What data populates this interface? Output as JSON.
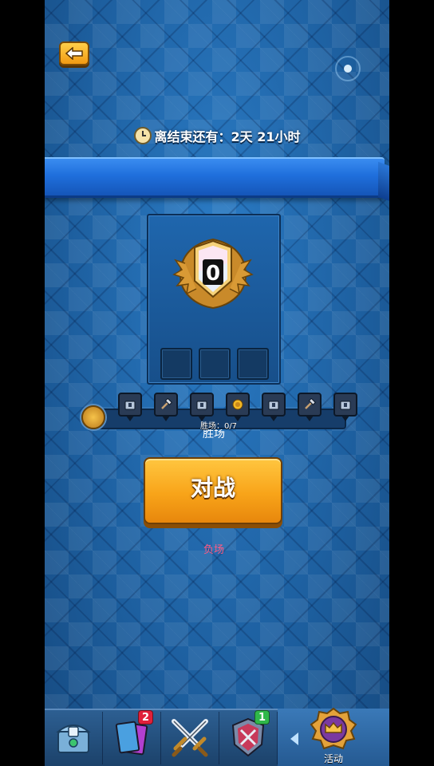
{
  "header": {
    "timer_text": "离结束还有：2天 21小时"
  },
  "panel": {
    "wins_title": "胜场",
    "wins_count": "0",
    "losses_label": "负场",
    "loss_slots": 3
  },
  "progress": {
    "label": "胜场：0/7",
    "current": 0,
    "total": 7,
    "rewards": [
      "chest-icon",
      "hammer-icon",
      "chest-icon",
      "coin-icon",
      "chest-icon",
      "hammer-icon",
      "chest-icon"
    ]
  },
  "battle": {
    "label": "对战"
  },
  "nav": {
    "items": [
      {
        "name": "chest",
        "badge": ""
      },
      {
        "name": "cards",
        "badge": "2",
        "badge_color": "#e0203a"
      },
      {
        "name": "battle",
        "badge": ""
      },
      {
        "name": "clan",
        "badge": "1",
        "badge_color": "#2fb84a"
      },
      {
        "name": "events",
        "badge": ""
      }
    ],
    "active_label": "活动"
  },
  "colors": {
    "accent": "#f8a419",
    "bg": "#1d5f9f",
    "loss": "#ff5a83"
  }
}
